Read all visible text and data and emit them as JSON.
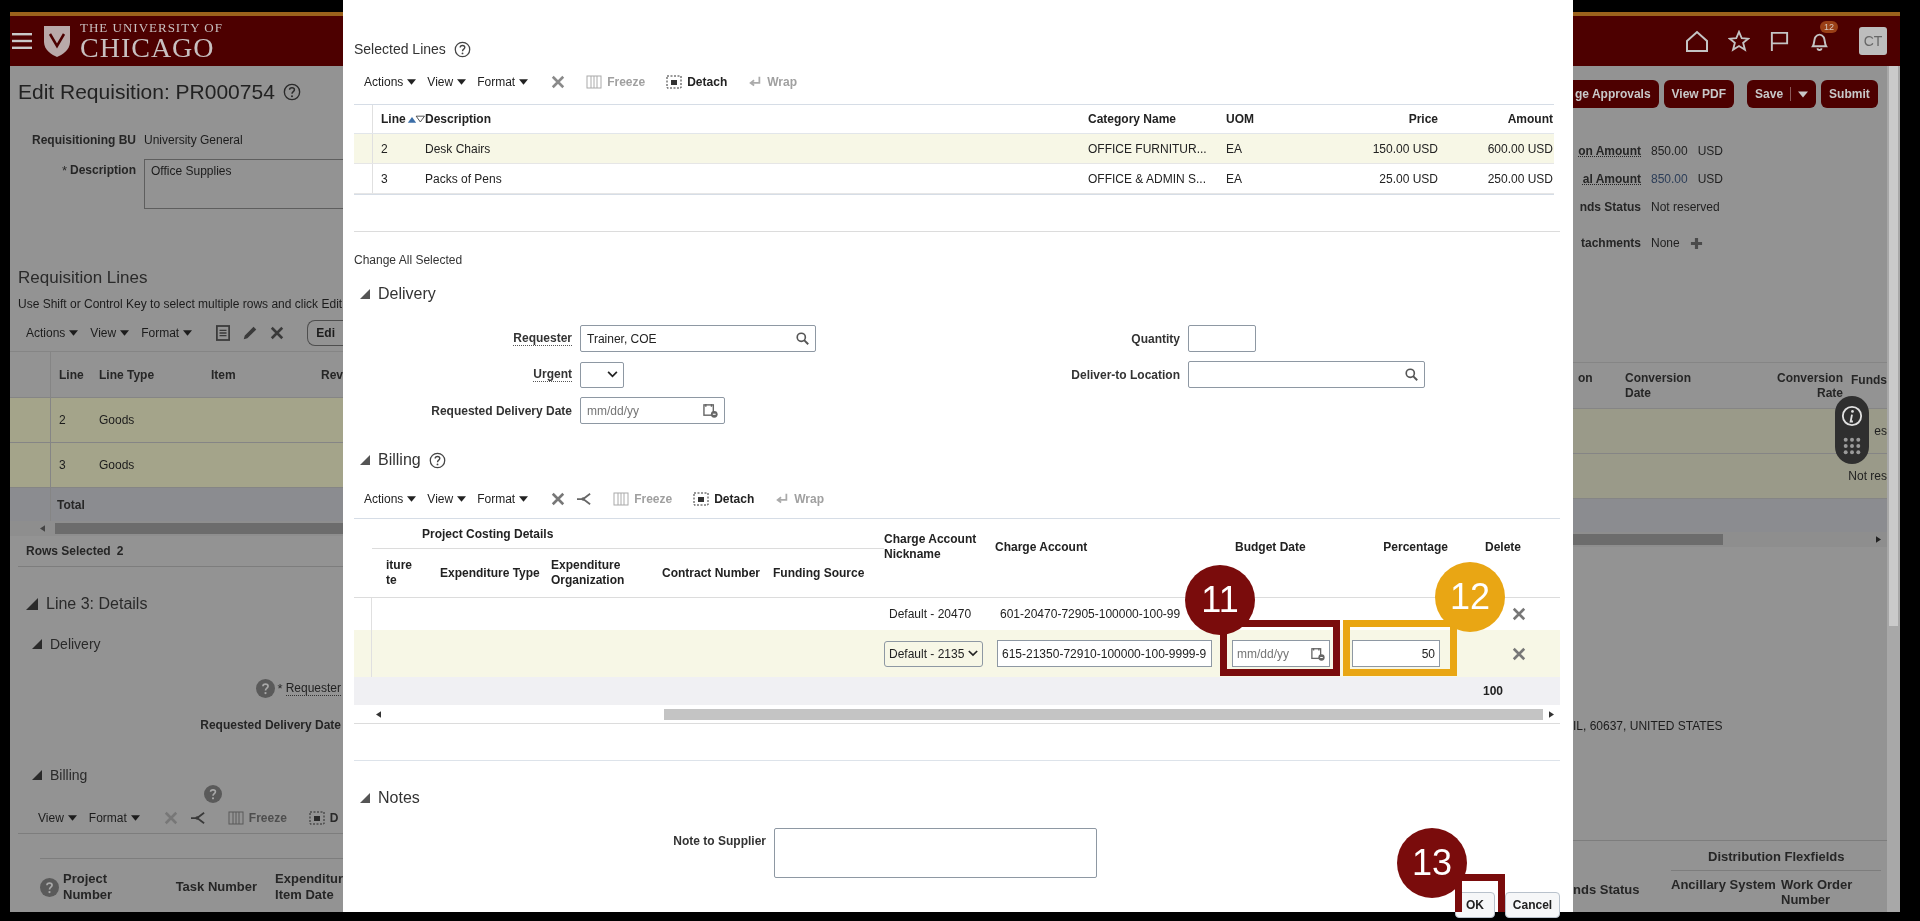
{
  "header": {
    "logo_top": "THE UNIVERSITY OF",
    "logo_bottom": "CHICAGO",
    "notification_count": "12",
    "user_initials": "CT"
  },
  "page": {
    "title": "Edit Requisition: PR000754",
    "fields": [
      {
        "label": "Requisitioning BU",
        "kind": "text",
        "value": "University General"
      },
      {
        "label": "Description",
        "kind": "textarea",
        "value": "Office Supplies",
        "marker": "*"
      }
    ],
    "lines": {
      "title": "Requisition Lines",
      "hint": "Use Shift or Control Key to select multiple rows and click Edit",
      "menus": [
        "Actions",
        "View",
        "Format"
      ],
      "edit_button": "Edi",
      "columns": [
        "Line",
        "Line Type",
        "Item",
        "Rev"
      ],
      "rows": [
        {
          "line": "2",
          "line_type": "Goods",
          "selected": true
        },
        {
          "line": "3",
          "line_type": "Goods",
          "selected": true
        }
      ],
      "total_label": "Total",
      "rows_selected_label": "Rows Selected",
      "rows_selected_value": "2"
    },
    "details": {
      "title": "Line 3: Details",
      "delivery_title": "Delivery",
      "requester_marker": "*",
      "requester_label": "Requester",
      "requested_delivery_date_label": "Requested Delivery Date",
      "billing_title": "Billing",
      "menus": [
        "View",
        "Format"
      ],
      "freeze": "Freeze",
      "detach": "D",
      "columns": [
        "Project Number",
        "Task Number",
        "Expenditur Item Date"
      ]
    }
  },
  "right": {
    "buttons": [
      {
        "label": "ge Approvals",
        "kind": "plain"
      },
      {
        "label": "View PDF",
        "kind": "plain"
      },
      {
        "label": "Save",
        "kind": "split"
      },
      {
        "label": "Submit",
        "kind": "plain"
      }
    ],
    "summary": [
      {
        "label": "on Amount",
        "value": "850.00",
        "currency": "USD",
        "link": false
      },
      {
        "label": "al Amount",
        "value": "850.00",
        "currency": "USD",
        "link": true
      },
      {
        "label": "nds Status",
        "value": "Not reserved"
      }
    ],
    "attachments": {
      "label": "tachments",
      "value": "None"
    },
    "columns": [
      "on",
      "Conversion Date",
      "Conversion Rate",
      "Funds"
    ],
    "row_cells": [
      "es",
      "Not res"
    ],
    "address": "IL, 60637, UNITED STATES",
    "flexfields_title": "Distribution Flexfields",
    "bottom_columns": [
      "nds Status",
      "Ancillary System",
      "Work Order Number"
    ]
  },
  "modal": {
    "selected_lines": {
      "title": "Selected Lines",
      "menus": [
        "Actions",
        "View",
        "Format"
      ],
      "tools": [
        {
          "label": "Freeze",
          "kind": "freeze",
          "disabled": true
        },
        {
          "label": "Detach",
          "kind": "detach",
          "disabled": false
        },
        {
          "label": "Wrap",
          "kind": "wrap",
          "disabled": true
        }
      ],
      "columns": [
        "Line",
        "Description",
        "Category Name",
        "UOM",
        "Price",
        "Amount"
      ],
      "rows": [
        {
          "line": "2",
          "description": "Desk Chairs",
          "category": "OFFICE FURNITUR...",
          "uom": "EA",
          "price": "150.00 USD",
          "amount": "600.00 USD",
          "selected": true
        },
        {
          "line": "3",
          "description": "Packs of Pens",
          "category": "OFFICE & ADMIN S...",
          "uom": "EA",
          "price": "25.00 USD",
          "amount": "250.00 USD",
          "selected": false
        }
      ]
    },
    "change_all_title": "Change All Selected",
    "delivery": {
      "title": "Delivery",
      "left_fields": [
        {
          "label": "Requester",
          "kind": "search",
          "value": "Trainer, COE",
          "help": true
        },
        {
          "label": "Urgent",
          "kind": "select",
          "help": true
        },
        {
          "label": "Requested Delivery Date",
          "kind": "date",
          "placeholder": "mm/dd/yy",
          "help": false
        }
      ],
      "right_fields": [
        {
          "label": "Quantity",
          "kind": "number",
          "help": false
        },
        {
          "label": "Deliver-to Location",
          "kind": "search",
          "help": false
        }
      ]
    },
    "billing": {
      "title": "Billing",
      "menus": [
        "Actions",
        "View",
        "Format"
      ],
      "tools": [
        {
          "label": "Freeze",
          "kind": "freeze",
          "disabled": true
        },
        {
          "label": "Detach",
          "kind": "detach",
          "disabled": false
        },
        {
          "label": "Wrap",
          "kind": "wrap",
          "disabled": true
        }
      ],
      "group_header": "Project Costing Details",
      "columns": [
        "iture te",
        "Expenditure Type",
        "Expenditure Organization",
        "Contract Number",
        "Funding Source",
        "Charge Account Nickname",
        "Charge Account",
        "Budget Date",
        "Percentage",
        "Delete"
      ],
      "rows": [
        {
          "kind": "readonly",
          "nickname": "Default - 20470",
          "account": "601-20470-72905-100000-100-99",
          "selected": false
        },
        {
          "kind": "editable",
          "nickname": "Default - 2135",
          "account": "615-21350-72910-100000-100-9999-9",
          "budget_placeholder": "mm/dd/yy",
          "percentage": "50",
          "selected": true
        }
      ],
      "total": "100"
    },
    "notes": {
      "title": "Notes",
      "note_label": "Note to Supplier"
    },
    "buttons": [
      {
        "label": "OK"
      },
      {
        "label": "Cancel"
      }
    ],
    "callouts": [
      {
        "number": "11",
        "color": "#7a0c0c"
      },
      {
        "number": "12",
        "color": "#e9a614"
      },
      {
        "number": "13",
        "color": "#7a0c0c"
      }
    ]
  }
}
